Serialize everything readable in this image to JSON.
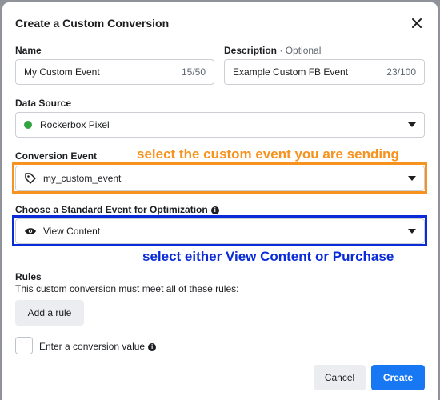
{
  "modal": {
    "title": "Create a Custom Conversion"
  },
  "name_field": {
    "label": "Name",
    "value": "My Custom Event",
    "count": "15/50"
  },
  "description_field": {
    "label": "Description",
    "optional": "· Optional",
    "value": "Example Custom FB Event",
    "count": "23/100"
  },
  "data_source": {
    "label": "Data Source",
    "value": "Rockerbox Pixel",
    "status_color": "#2fa43f"
  },
  "conversion_event": {
    "label": "Conversion Event",
    "value": "my_custom_event",
    "icon": "tag-icon"
  },
  "standard_event": {
    "label": "Choose a Standard Event for Optimization",
    "value": "View Content",
    "icon": "eye-icon"
  },
  "annotations": {
    "orange": "select the custom event you are sending",
    "blue": "select either View Content or Purchase",
    "orange_color": "#f7921e",
    "blue_color": "#0a2bd8"
  },
  "rules": {
    "title": "Rules",
    "description": "This custom conversion must meet all of these rules:",
    "add_rule_label": "Add a rule"
  },
  "conversion_value": {
    "label": "Enter a conversion value"
  },
  "footer": {
    "cancel_label": "Cancel",
    "create_label": "Create",
    "primary_color": "#1877f2"
  }
}
